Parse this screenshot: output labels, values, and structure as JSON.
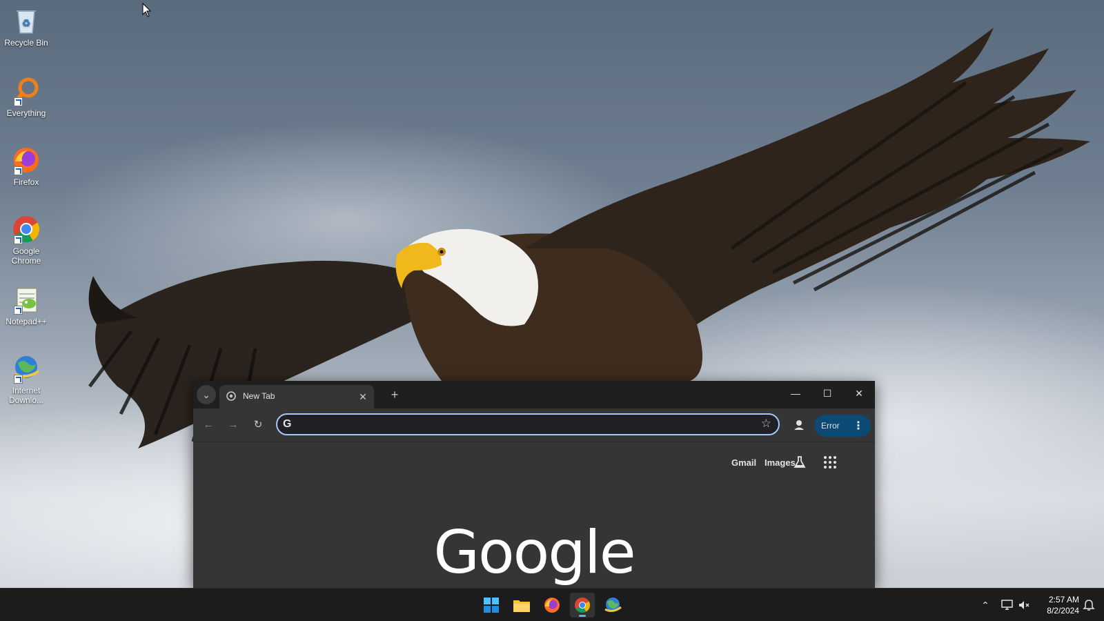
{
  "desktop": {
    "icons": [
      {
        "label": "Recycle Bin"
      },
      {
        "label": "Everything"
      },
      {
        "label": "Firefox"
      },
      {
        "label": "Google Chrome"
      },
      {
        "label": "Notepad++"
      },
      {
        "label": "Internet Downlo..."
      }
    ]
  },
  "chrome": {
    "tab_title": "New Tab",
    "omnibox_value": "",
    "error_label": "Error",
    "ntp": {
      "gmail_link": "Gmail",
      "images_link": "Images",
      "logo_text": "Google"
    }
  },
  "taskbar": {
    "time": "2:57 AM",
    "date": "8/2/2024"
  },
  "colors": {
    "accent": "#a8c7fa",
    "error_chip": "#0b4a74",
    "active_indicator": "#5fb2f2"
  }
}
